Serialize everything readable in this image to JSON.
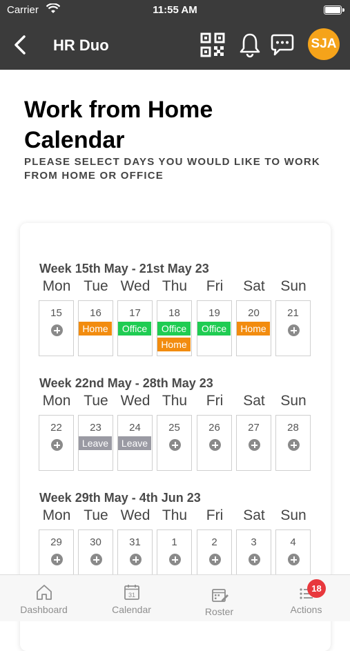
{
  "status_bar": {
    "carrier": "Carrier",
    "time": "11:55 AM"
  },
  "nav": {
    "title": "HR Duo",
    "avatar_initials": "SJA"
  },
  "page": {
    "title": "Work from Home Calendar",
    "subtitle": "PLEASE SELECT DAYS YOU WOULD LIKE TO WORK FROM HOME OR OFFICE"
  },
  "day_names": [
    "Mon",
    "Tue",
    "Wed",
    "Thu",
    "Fri",
    "Sat",
    "Sun"
  ],
  "weeks": [
    {
      "title": "Week 15th May - 21st May 23",
      "days": [
        {
          "num": "15",
          "tags": []
        },
        {
          "num": "16",
          "tags": [
            "Home"
          ]
        },
        {
          "num": "17",
          "tags": [
            "Office"
          ]
        },
        {
          "num": "18",
          "tags": [
            "Office",
            "Home"
          ]
        },
        {
          "num": "19",
          "tags": [
            "Office"
          ]
        },
        {
          "num": "20",
          "tags": [
            "Home"
          ]
        },
        {
          "num": "21",
          "tags": []
        }
      ]
    },
    {
      "title": "Week 22nd May - 28th May 23",
      "days": [
        {
          "num": "22",
          "tags": []
        },
        {
          "num": "23",
          "tags": [
            "Leave"
          ]
        },
        {
          "num": "24",
          "tags": [
            "Leave"
          ]
        },
        {
          "num": "25",
          "tags": []
        },
        {
          "num": "26",
          "tags": []
        },
        {
          "num": "27",
          "tags": []
        },
        {
          "num": "28",
          "tags": []
        }
      ]
    },
    {
      "title": "Week 29th May - 4th Jun 23",
      "days": [
        {
          "num": "29",
          "tags": []
        },
        {
          "num": "30",
          "tags": []
        },
        {
          "num": "31",
          "tags": []
        },
        {
          "num": "1",
          "tags": []
        },
        {
          "num": "2",
          "tags": []
        },
        {
          "num": "3",
          "tags": []
        },
        {
          "num": "4",
          "tags": []
        }
      ]
    }
  ],
  "tabs": [
    {
      "label": "Dashboard",
      "icon": "home-icon"
    },
    {
      "label": "Calendar",
      "icon": "calendar-icon",
      "icon_text": "31"
    },
    {
      "label": "Roster",
      "icon": "roster-icon"
    },
    {
      "label": "Actions",
      "icon": "list-icon",
      "badge": "18"
    }
  ],
  "colors": {
    "header": "#3b3b3b",
    "avatar": "#f5a31a",
    "home": "#f28c0f",
    "office": "#1fcc52",
    "leave": "#9a9aa3",
    "badge": "#e8383d"
  }
}
